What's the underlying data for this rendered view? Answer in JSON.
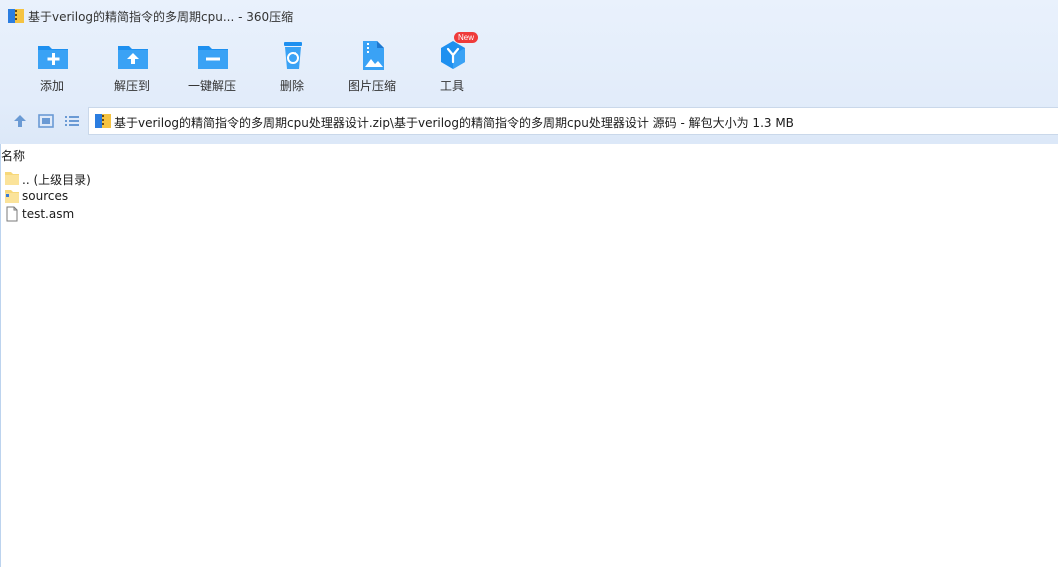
{
  "window": {
    "title": "基于verilog的精简指令的多周期cpu... - 360压缩"
  },
  "toolbar": {
    "items": [
      {
        "label": "添加",
        "icon": "add-icon"
      },
      {
        "label": "解压到",
        "icon": "extract-to-icon"
      },
      {
        "label": "一键解压",
        "icon": "one-click-extract-icon"
      },
      {
        "label": "删除",
        "icon": "delete-icon"
      },
      {
        "label": "图片压缩",
        "icon": "image-compress-icon"
      },
      {
        "label": "工具",
        "icon": "tools-icon",
        "badge": "New"
      }
    ]
  },
  "address": {
    "path": "基于verilog的精简指令的多周期cpu处理器设计.zip\\基于verilog的精简指令的多周期cpu处理器设计 源码 - 解包大小为 1.3 MB"
  },
  "filelist": {
    "column_name": "名称",
    "items": [
      {
        "name": ".. (上级目录)",
        "type": "parent-folder"
      },
      {
        "name": "sources",
        "type": "folder"
      },
      {
        "name": "test.asm",
        "type": "file"
      }
    ]
  },
  "colors": {
    "accent": "#1e90f0",
    "folder": "#f7d87a",
    "badge": "#ef3b3b",
    "toolbar_bg": "#e2ecfa"
  }
}
